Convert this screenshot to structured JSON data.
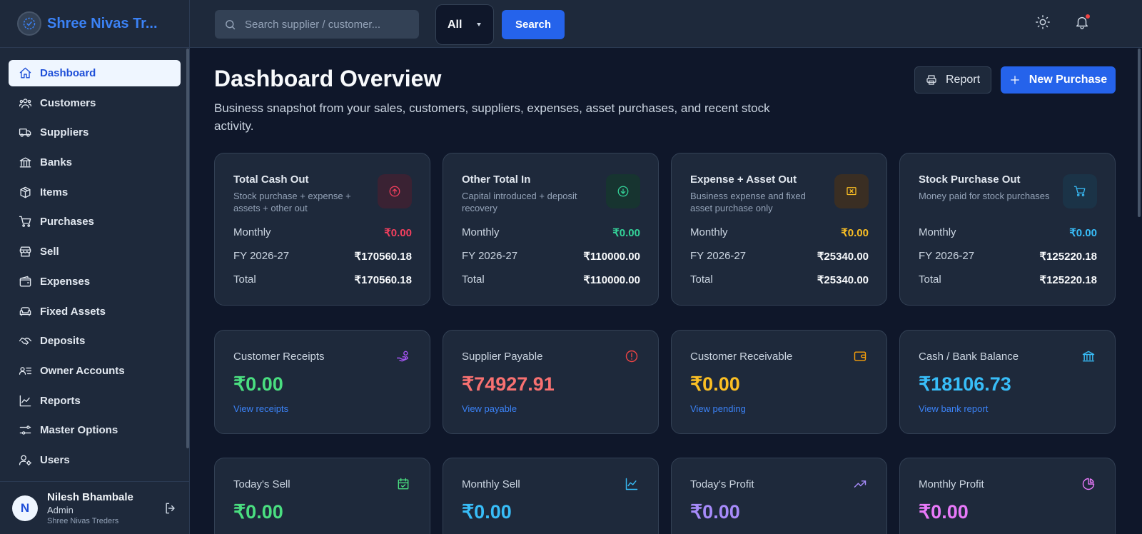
{
  "brand": {
    "name": "Shree Nivas Tr..."
  },
  "sidebar": {
    "items": [
      {
        "label": "Dashboard",
        "icon": "home-icon"
      },
      {
        "label": "Customers",
        "icon": "users-icon"
      },
      {
        "label": "Suppliers",
        "icon": "truck-icon"
      },
      {
        "label": "Banks",
        "icon": "bank-icon"
      },
      {
        "label": "Items",
        "icon": "box-icon"
      },
      {
        "label": "Purchases",
        "icon": "cart-icon"
      },
      {
        "label": "Sell",
        "icon": "store-icon"
      },
      {
        "label": "Expenses",
        "icon": "wallet-icon"
      },
      {
        "label": "Fixed Assets",
        "icon": "sofa-icon"
      },
      {
        "label": "Deposits",
        "icon": "handshake-icon"
      },
      {
        "label": "Owner Accounts",
        "icon": "id-list-icon"
      },
      {
        "label": "Reports",
        "icon": "chart-icon"
      },
      {
        "label": "Master Options",
        "icon": "sliders-icon"
      },
      {
        "label": "Users",
        "icon": "user-gear-icon"
      }
    ]
  },
  "user": {
    "initial": "N",
    "name": "Nilesh Bhambale",
    "role": "Admin",
    "company": "Shree Nivas Treders"
  },
  "topbar": {
    "search_placeholder": "Search supplier / customer...",
    "filter_value": "All",
    "search_label": "Search"
  },
  "header": {
    "title": "Dashboard Overview",
    "subtitle": "Business snapshot from your sales, customers, suppliers, expenses, asset purchases, and recent stock activity.",
    "report_label": "Report",
    "new_purchase_label": "New Purchase"
  },
  "summary_cards": [
    {
      "title": "Total Cash Out",
      "desc": "Stock purchase + expense + assets + other out",
      "monthly_label": "Monthly",
      "monthly": "₹0.00",
      "fy_label": "FY 2026-27",
      "fy": "₹170560.18",
      "total_label": "Total",
      "total": "₹170560.18",
      "color": "#f43f5e"
    },
    {
      "title": "Other Total In",
      "desc": "Capital introduced + deposit recovery",
      "monthly_label": "Monthly",
      "monthly": "₹0.00",
      "fy_label": "FY 2026-27",
      "fy": "₹110000.00",
      "total_label": "Total",
      "total": "₹110000.00",
      "color": "#34d399"
    },
    {
      "title": "Expense + Asset Out",
      "desc": "Business expense and fixed asset purchase only",
      "monthly_label": "Monthly",
      "monthly": "₹0.00",
      "fy_label": "FY 2026-27",
      "fy": "₹25340.00",
      "total_label": "Total",
      "total": "₹25340.00",
      "color": "#fbbf24"
    },
    {
      "title": "Stock Purchase Out",
      "desc": "Money paid for stock purchases",
      "monthly_label": "Monthly",
      "monthly": "₹0.00",
      "fy_label": "FY 2026-27",
      "fy": "₹125220.18",
      "total_label": "Total",
      "total": "₹125220.18",
      "color": "#38bdf8"
    }
  ],
  "stat_cards": [
    {
      "title": "Customer Receipts",
      "value": "₹0.00",
      "link": "View receipts",
      "color": "#4ade80",
      "icon": "hand-coin-icon",
      "icon_color": "#a855f7"
    },
    {
      "title": "Supplier Payable",
      "value": "₹74927.91",
      "link": "View payable",
      "color": "#f87171",
      "icon": "alert-circle-icon",
      "icon_color": "#ef4444"
    },
    {
      "title": "Customer Receivable",
      "value": "₹0.00",
      "link": "View pending",
      "color": "#fbbf24",
      "icon": "wallet-icon",
      "icon_color": "#f59e0b"
    },
    {
      "title": "Cash / Bank Balance",
      "value": "₹18106.73",
      "link": "View bank report",
      "color": "#38bdf8",
      "icon": "bank-icon",
      "icon_color": "#38bdf8"
    }
  ],
  "sell_cards": [
    {
      "title": "Today's Sell",
      "value": "₹0.00",
      "color": "#4ade80",
      "icon": "calendar-check-icon",
      "icon_color": "#4ade80"
    },
    {
      "title": "Monthly Sell",
      "value": "₹0.00",
      "color": "#38bdf8",
      "icon": "line-chart-icon",
      "icon_color": "#38bdf8"
    },
    {
      "title": "Today's Profit",
      "value": "₹0.00",
      "color": "#a78bfa",
      "icon": "trending-up-icon",
      "icon_color": "#a78bfa"
    },
    {
      "title": "Monthly Profit",
      "value": "₹0.00",
      "color": "#e879f9",
      "icon": "pie-chart-icon",
      "icon_color": "#e879f9"
    }
  ]
}
